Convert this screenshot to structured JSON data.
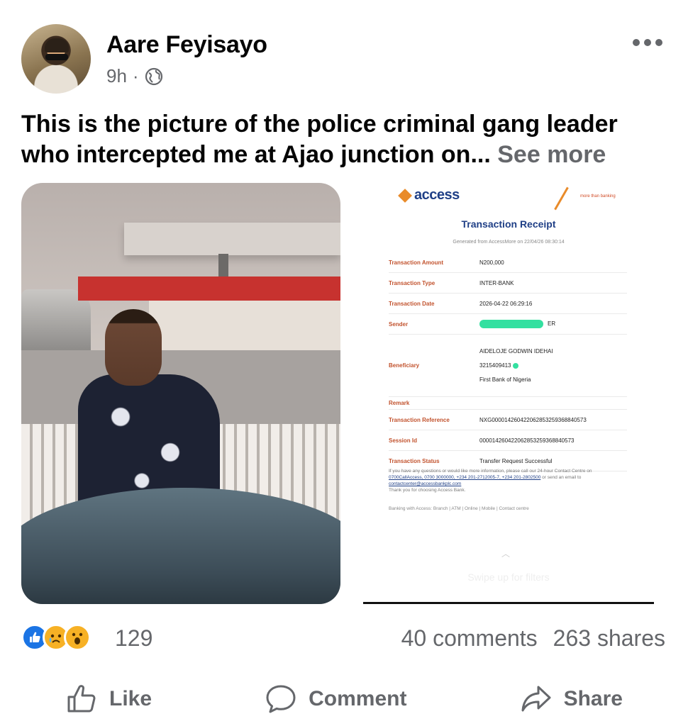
{
  "post": {
    "author": "Aare Feyisayo",
    "time": "9h",
    "separator": "·",
    "text": "This is the picture of the police criminal gang leader who intercepted me at Ajao junction on...",
    "see_more": "See more"
  },
  "receipt": {
    "logo": "access",
    "tagline": "more than banking",
    "title": "Transaction Receipt",
    "generated": "Generated from AccessMore on 22/04/26 08:30:14",
    "rows": [
      {
        "label": "Transaction Amount",
        "value": "N200,000"
      },
      {
        "label": "Transaction Type",
        "value": "INTER-BANK"
      },
      {
        "label": "Transaction Date",
        "value": "2026-04-22 06:29:16"
      },
      {
        "label": "Sender",
        "value": "ER"
      },
      {
        "label": "Beneficiary",
        "values": [
          "AIDELOJE GODWIN IDEHAI",
          "3215409413",
          "First Bank of Nigeria"
        ]
      },
      {
        "label": "Remark",
        "value": ""
      },
      {
        "label": "Transaction Reference",
        "value": "NXG000014260422062853259368840573"
      },
      {
        "label": "Session Id",
        "value": "000014260422062853259368840573"
      },
      {
        "label": "Transaction Status",
        "value": "Transfer Request Successful"
      }
    ],
    "footer_line1": "If you have any questions or would like more information, please call our 24-hour Contact Centre on",
    "footer_links": "0700CallAccess, 0700 3000000, +234 201-2712005-7, +234 201-2802500",
    "footer_after_links": " or send an email to",
    "footer_email": "contactcenter@accessbankplc.com",
    "footer_thanks": "Thank you for choosing Access Bank.",
    "banking_with": "Banking with Access: Branch | ATM | Online | Mobile | Contact centre",
    "swipe": "Swipe up for filters"
  },
  "stats": {
    "reaction_count": "129",
    "comments": "40 comments",
    "shares": "263 shares"
  },
  "actions": {
    "like": "Like",
    "comment": "Comment",
    "share": "Share"
  },
  "colors": {
    "fb_blue": "#1b74e4",
    "meta_gray": "#65676b",
    "access_blue": "#1f3f86",
    "access_orange": "#e98b2a"
  }
}
